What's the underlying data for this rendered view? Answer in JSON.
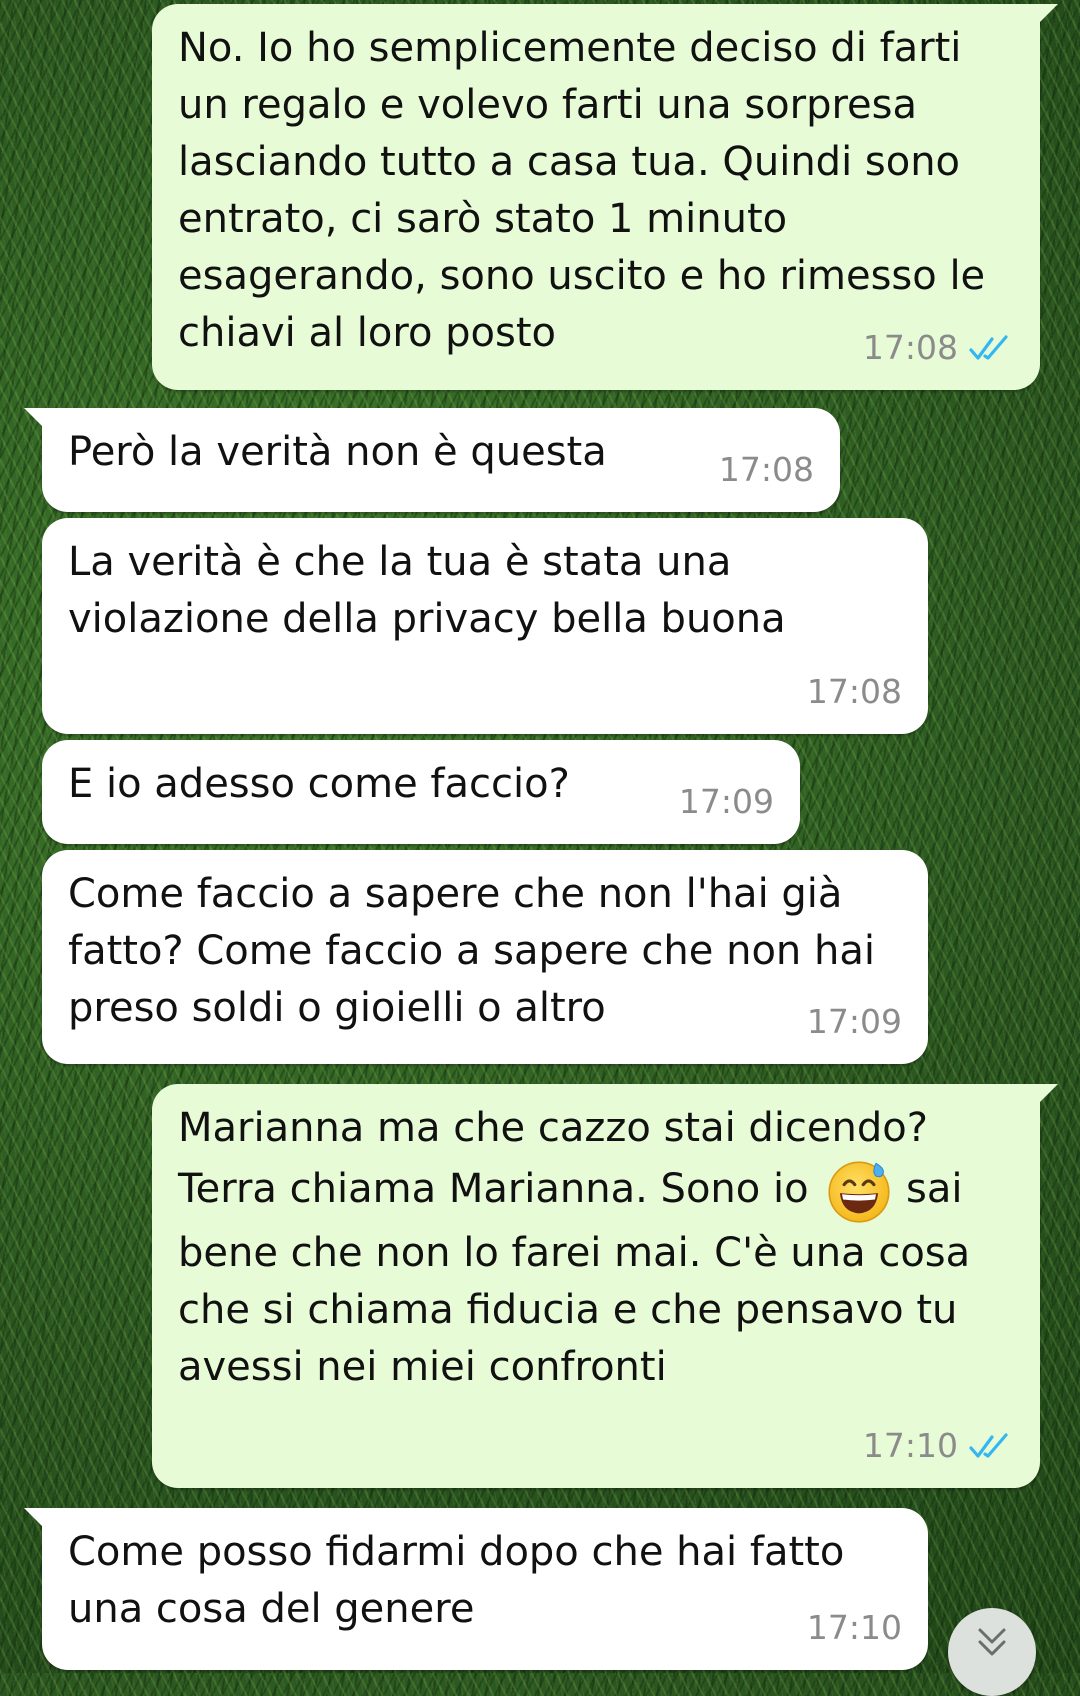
{
  "messages": [
    {
      "direction": "outgoing",
      "text": "No. Io ho semplicemente deciso di farti un regalo e volevo farti una sorpresa lasciando tutto a casa tua. Quindi sono entrato, ci sarò stato 1 minuto esagerando, sono uscito e ho rimesso le chiavi al loro posto",
      "time": "17:08",
      "status": "read",
      "status_icon": "double-check-icon"
    },
    {
      "direction": "incoming",
      "text": "Però la verità non è questa",
      "time": "17:08"
    },
    {
      "direction": "incoming",
      "text": "La verità è che la tua è stata una violazione della privacy bella buona",
      "time": "17:08"
    },
    {
      "direction": "incoming",
      "text": "E io adesso come faccio?",
      "time": "17:09"
    },
    {
      "direction": "incoming",
      "text": "Come faccio a sapere che non l'hai già fatto? Come faccio a sapere che non hai preso soldi o gioielli o altro",
      "time": "17:09"
    },
    {
      "direction": "outgoing",
      "text_before_emoji": "Marianna ma che cazzo stai dicendo? Terra chiama Marianna. Sono io",
      "emoji": "grinning-face-with-sweat-emoji",
      "text_after_emoji": "sai bene che non lo farei mai. C'è una cosa che si chiama fiducia e che pensavo tu avessi nei miei confronti",
      "time": "17:10",
      "status": "read",
      "status_icon": "double-check-icon"
    },
    {
      "direction": "incoming",
      "text": "Come posso fidarmi dopo che hai fatto una cosa del genere",
      "time": "17:10"
    }
  ],
  "scroll_button_icon": "chevron-double-down-icon",
  "colors": {
    "incoming_bubble": "#ffffff",
    "outgoing_bubble": "#e7fcd6",
    "read_ticks": "#34b7f1",
    "timestamp": "#8b8b8b"
  }
}
